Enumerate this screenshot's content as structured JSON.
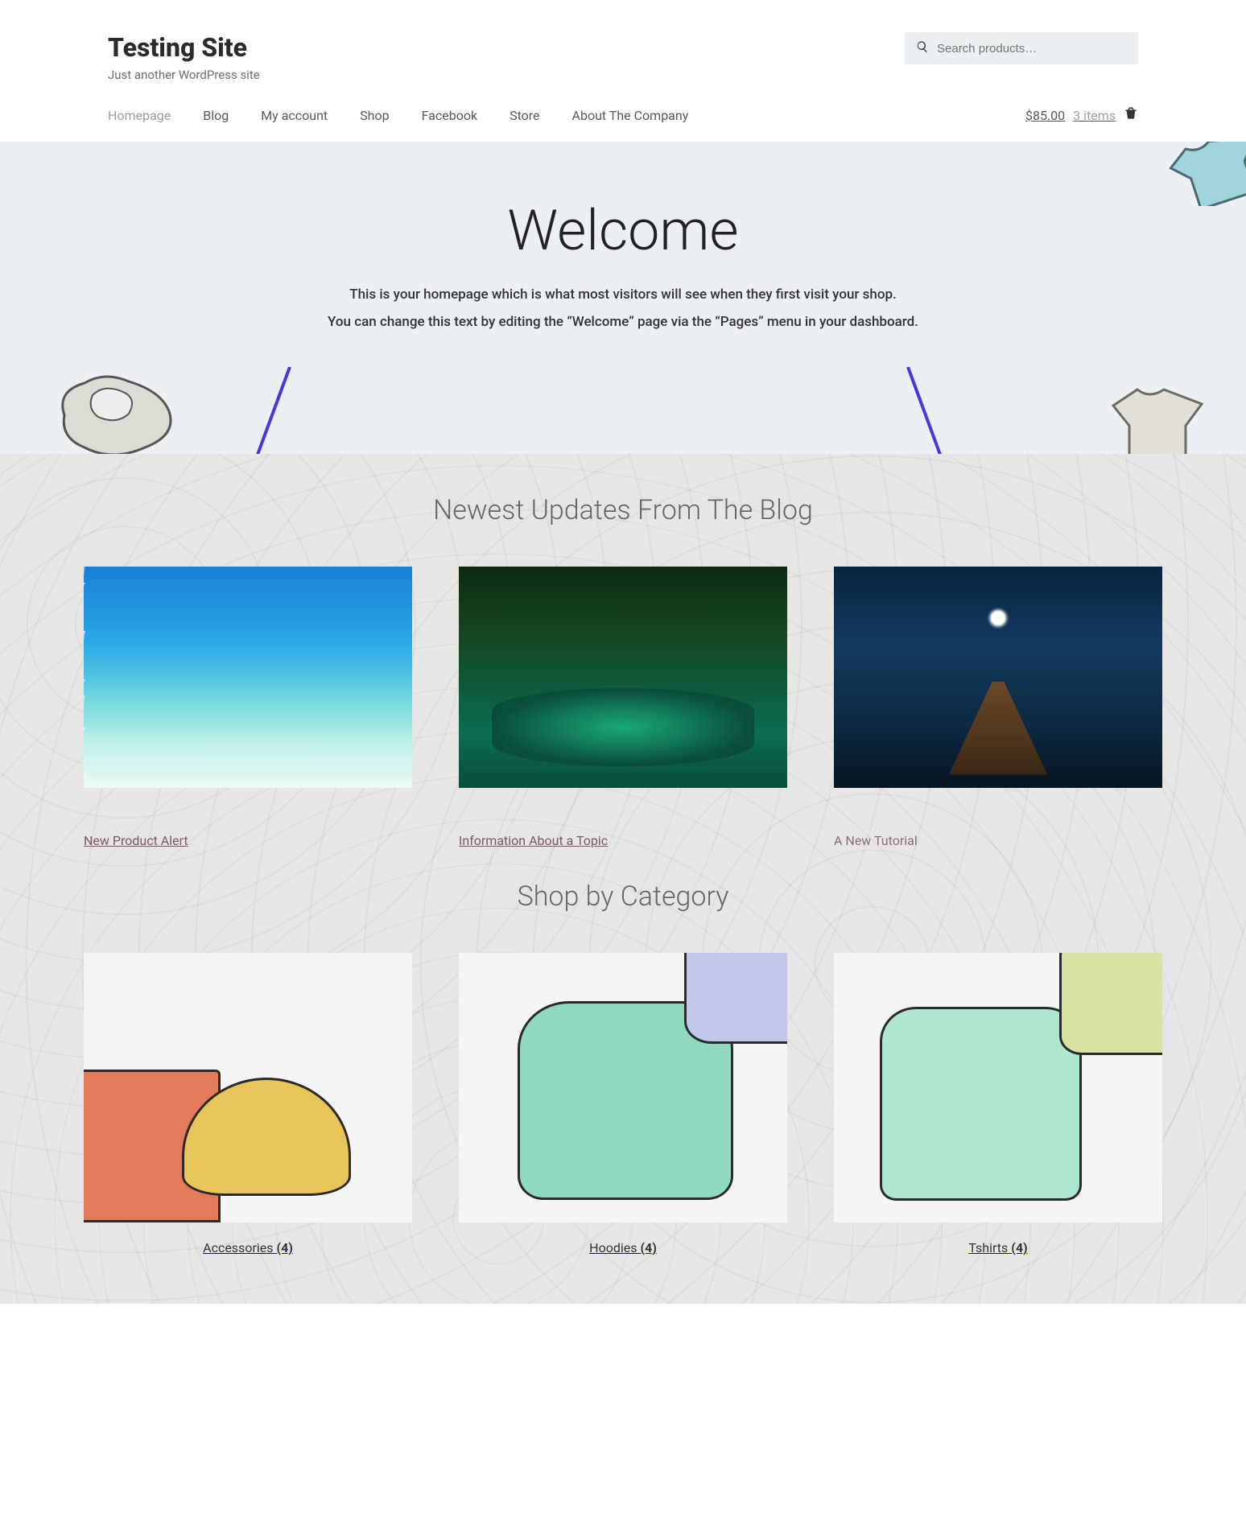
{
  "site": {
    "title": "Testing Site",
    "tagline": "Just another WordPress site"
  },
  "search": {
    "placeholder": "Search products…"
  },
  "nav": [
    {
      "label": "Homepage",
      "active": true
    },
    {
      "label": "Blog"
    },
    {
      "label": "My account"
    },
    {
      "label": "Shop"
    },
    {
      "label": "Facebook"
    },
    {
      "label": "Store"
    },
    {
      "label": "About The Company"
    }
  ],
  "cart": {
    "total": "$85.00",
    "items": "3 items"
  },
  "hero": {
    "title": "Welcome",
    "line1": "This is your homepage which is what most visitors will see when they first visit your shop.",
    "line2": "You can change this text by editing the “Welcome” page via the “Pages” menu in your dashboard."
  },
  "blog_section_title": "Newest Updates From The Blog",
  "blog": [
    {
      "title": "New Product Alert",
      "link": true
    },
    {
      "title": "Information About a Topic",
      "link": true
    },
    {
      "title": "A New Tutorial",
      "link": false
    }
  ],
  "category_section_title": "Shop by Category",
  "categories": [
    {
      "name": "Accessories",
      "count": "(4)"
    },
    {
      "name": "Hoodies",
      "count": "(4)"
    },
    {
      "name": "Tshirts",
      "count": "(4)"
    }
  ]
}
